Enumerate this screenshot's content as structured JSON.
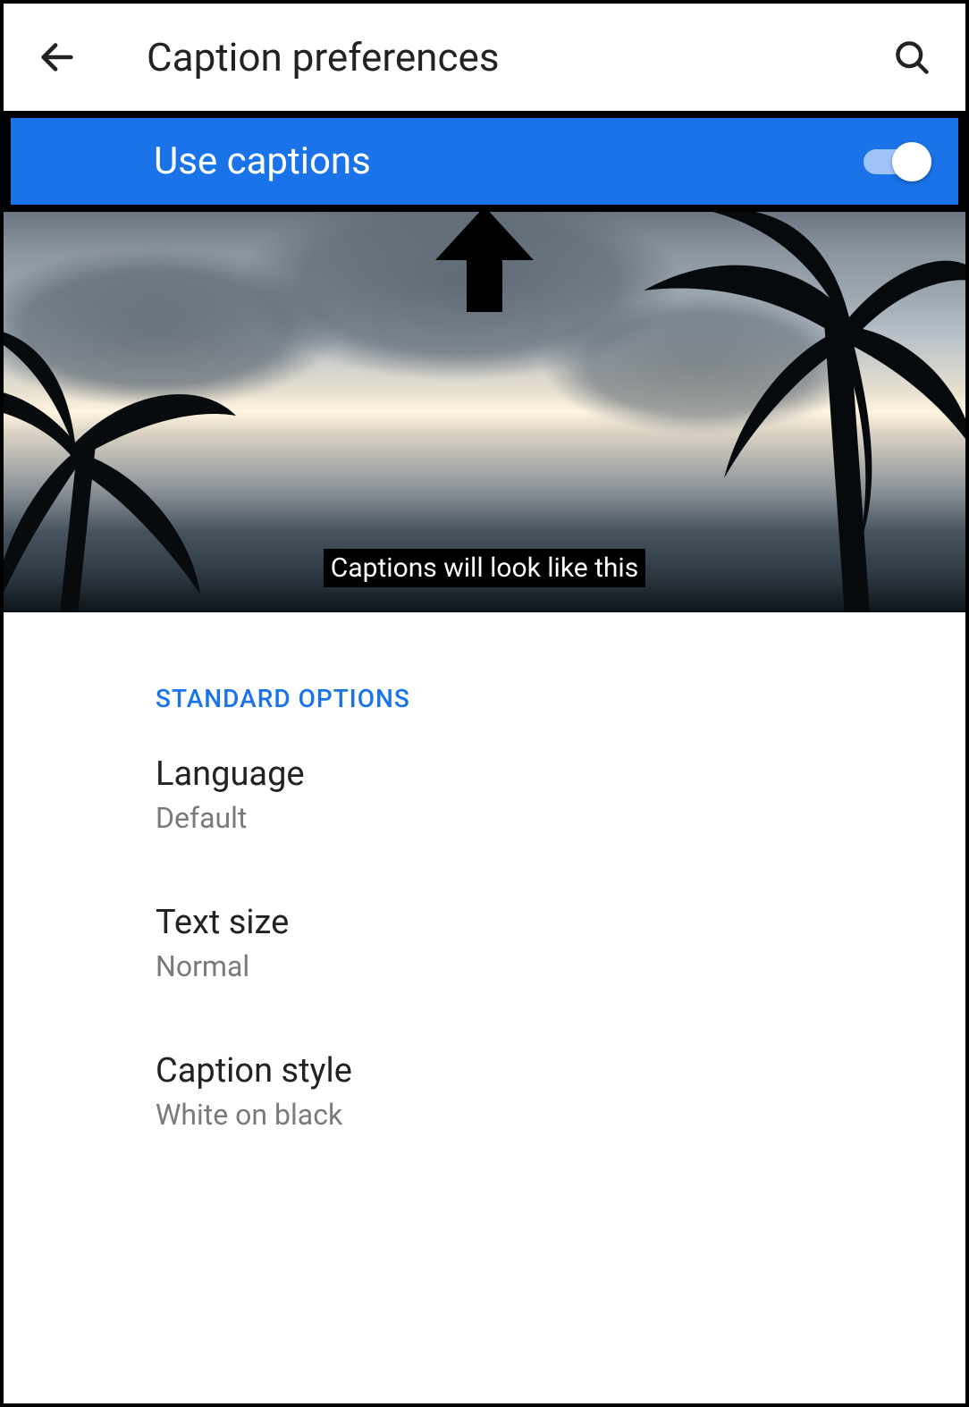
{
  "header": {
    "title": "Caption preferences"
  },
  "toggle": {
    "label": "Use captions",
    "on": true
  },
  "preview": {
    "caption_sample": "Captions will look like this"
  },
  "section": {
    "heading": "STANDARD OPTIONS"
  },
  "options": [
    {
      "title": "Language",
      "value": "Default"
    },
    {
      "title": "Text size",
      "value": "Normal"
    },
    {
      "title": "Caption style",
      "value": "White on black"
    }
  ],
  "icons": {
    "back": "arrow-left",
    "search": "search",
    "annotation_arrow": "arrow-up"
  },
  "colors": {
    "accent": "#1a73e8"
  }
}
